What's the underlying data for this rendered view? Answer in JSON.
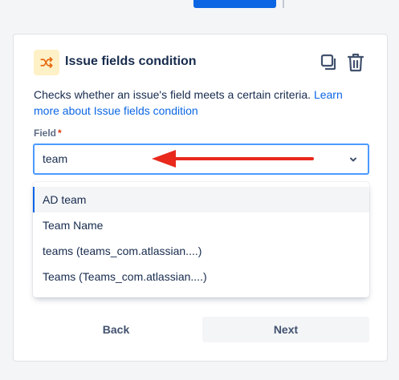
{
  "panel": {
    "title": "Issue fields condition",
    "header_icon": "shuffle-icon",
    "actions": {
      "copy_icon": "copy-icon",
      "delete_icon": "trash-icon"
    },
    "description": "Checks whether an issue's field meets a certain criteria.",
    "learn_more_link": "Learn more about Issue fields condition"
  },
  "field": {
    "label": "Field",
    "required_marker": "*",
    "value": "team"
  },
  "dropdown": {
    "options": [
      "AD team",
      "Team Name",
      "teams (teams_com.atlassian....)",
      "Teams (Teams_com.atlassian....)"
    ],
    "highlighted_index": 0
  },
  "footer": {
    "back_label": "Back",
    "next_label": "Next"
  },
  "colors": {
    "accent": "#0c66e4",
    "annotation_arrow": "#e8291c",
    "header_icon_bg": "#fff1c7",
    "header_icon_fg": "#e56910"
  }
}
